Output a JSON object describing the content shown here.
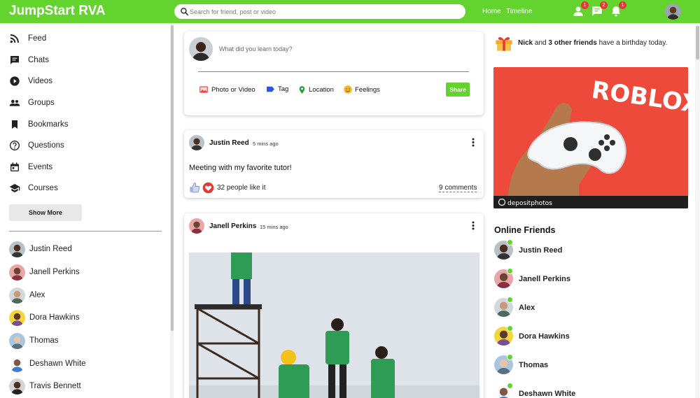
{
  "header": {
    "brand": "JumpStart RVA",
    "search_placeholder": "Search for friend, post or video",
    "links": {
      "home": "Home",
      "timeline": "Timeline"
    },
    "badges": {
      "friends": "1",
      "messages": "2",
      "notifications": "1"
    }
  },
  "colors": {
    "brand_green": "#63d32d",
    "badge_red": "#e53935",
    "ad_red": "#ee4a3b",
    "like_red": "#e53935"
  },
  "sidebar": {
    "nav": [
      {
        "label": "Feed",
        "icon": "rss-icon"
      },
      {
        "label": "Chats",
        "icon": "chat-icon"
      },
      {
        "label": "Videos",
        "icon": "play-circle-icon"
      },
      {
        "label": "Groups",
        "icon": "group-icon"
      },
      {
        "label": "Bookmarks",
        "icon": "bookmark-icon"
      },
      {
        "label": "Questions",
        "icon": "help-circle-icon"
      },
      {
        "label": "Events",
        "icon": "calendar-icon"
      },
      {
        "label": "Courses",
        "icon": "graduation-cap-icon"
      }
    ],
    "show_more": "Show More",
    "friends": [
      "Justin Reed",
      "Janell Perkins",
      "Alex",
      "Dora Hawkins",
      "Thomas",
      "Deshawn White",
      "Travis Bennett"
    ]
  },
  "composer": {
    "placeholder": "What did you learn today?",
    "options": {
      "photo": "Photo or Video",
      "tag": "Tag",
      "location": "Location",
      "feelings": "Feelings"
    },
    "share": "Share"
  },
  "posts": [
    {
      "author": "Justin Reed",
      "time": "5 mins ago",
      "text": "Meeting with my favorite tutor!",
      "likes": "32 people like it",
      "comments": "9 comments"
    },
    {
      "author": "Janell Perkins",
      "time": "15 mins ago"
    }
  ],
  "rightbar": {
    "birthday": {
      "name": "Nick",
      "mid": " and ",
      "others": "3 other friends",
      "tail": " have a birthday today."
    },
    "ad": {
      "brand": "ROBLOX",
      "watermark": "depositphotos"
    },
    "online_title": "Online Friends",
    "online": [
      "Justin Reed",
      "Janell Perkins",
      "Alex",
      "Dora Hawkins",
      "Thomas",
      "Deshawn White"
    ]
  }
}
